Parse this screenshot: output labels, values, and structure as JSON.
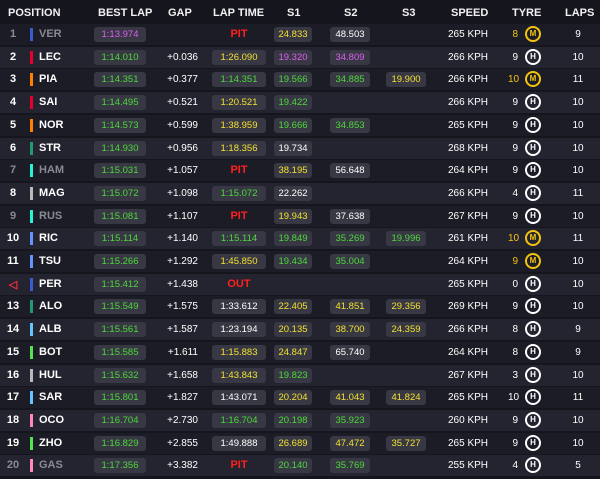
{
  "headers": {
    "position": "POSITION",
    "best_lap": "BEST LAP",
    "gap": "GAP",
    "lap_time": "LAP TIME",
    "s1": "S1",
    "s2": "S2",
    "s3": "S3",
    "speed": "SPEED",
    "tyre": "TYRE",
    "laps": "LAPS"
  },
  "colors": {
    "purple": "#e05cf5",
    "green": "#4cd93a",
    "yellow": "#f2e12e",
    "white": "#ffffff",
    "pit_red": "#ff2020",
    "tyre_medium": "#f2c40f",
    "tyre_hard": "#ffffff"
  },
  "rows": [
    {
      "pos": "1",
      "code": "VER",
      "team": "#3a5bd0",
      "dim": true,
      "best": "1:13.974",
      "best_c": "purple",
      "gap": "",
      "lap": "PIT",
      "lap_c": "pit",
      "s1": "24.833",
      "s1_c": "yellow",
      "s2": "48.503",
      "s2_c": "white",
      "s3": "",
      "s3_c": "",
      "speed": "265 KPH",
      "age": "8",
      "tyre": "M",
      "tyre_c": "yellow",
      "laps": "9"
    },
    {
      "pos": "2",
      "code": "LEC",
      "team": "#e8002d",
      "dim": false,
      "best": "1:14.010",
      "best_c": "green",
      "gap": "+0.036",
      "lap": "1:26.090",
      "lap_c": "yellow",
      "s1": "19.320",
      "s1_c": "purple",
      "s2": "34.809",
      "s2_c": "purple",
      "s3": "",
      "s3_c": "",
      "speed": "266 KPH",
      "age": "9",
      "tyre": "H",
      "tyre_c": "white",
      "laps": "10"
    },
    {
      "pos": "3",
      "code": "PIA",
      "team": "#ff8000",
      "dim": false,
      "best": "1:14.351",
      "best_c": "green",
      "gap": "+0.377",
      "lap": "1:14.351",
      "lap_c": "green",
      "s1": "19.566",
      "s1_c": "green",
      "s2": "34.885",
      "s2_c": "green",
      "s3": "19.900",
      "s3_c": "yellow",
      "speed": "266 KPH",
      "age": "10",
      "tyre": "M",
      "tyre_c": "yellow",
      "laps": "11"
    },
    {
      "pos": "4",
      "code": "SAI",
      "team": "#e8002d",
      "dim": false,
      "best": "1:14.495",
      "best_c": "green",
      "gap": "+0.521",
      "lap": "1:20.521",
      "lap_c": "yellow",
      "s1": "19.422",
      "s1_c": "green",
      "s2": "",
      "s2_c": "",
      "s3": "",
      "s3_c": "",
      "speed": "266 KPH",
      "age": "9",
      "tyre": "H",
      "tyre_c": "white",
      "laps": "10"
    },
    {
      "pos": "5",
      "code": "NOR",
      "team": "#ff8000",
      "dim": false,
      "best": "1:14.573",
      "best_c": "green",
      "gap": "+0.599",
      "lap": "1:38.959",
      "lap_c": "yellow",
      "s1": "19.666",
      "s1_c": "green",
      "s2": "34.853",
      "s2_c": "green",
      "s3": "",
      "s3_c": "",
      "speed": "265 KPH",
      "age": "9",
      "tyre": "H",
      "tyre_c": "white",
      "laps": "10"
    },
    {
      "pos": "6",
      "code": "STR",
      "team": "#229971",
      "dim": false,
      "best": "1:14.930",
      "best_c": "green",
      "gap": "+0.956",
      "lap": "1:18.356",
      "lap_c": "yellow",
      "s1": "19.734",
      "s1_c": "white",
      "s2": "",
      "s2_c": "",
      "s3": "",
      "s3_c": "",
      "speed": "268 KPH",
      "age": "9",
      "tyre": "H",
      "tyre_c": "white",
      "laps": "10"
    },
    {
      "pos": "7",
      "code": "HAM",
      "team": "#27f4d2",
      "dim": true,
      "best": "1:15.031",
      "best_c": "green",
      "gap": "+1.057",
      "lap": "PIT",
      "lap_c": "pit",
      "s1": "38.195",
      "s1_c": "yellow",
      "s2": "56.648",
      "s2_c": "white",
      "s3": "",
      "s3_c": "",
      "speed": "264 KPH",
      "age": "9",
      "tyre": "H",
      "tyre_c": "white",
      "laps": "10"
    },
    {
      "pos": "8",
      "code": "MAG",
      "team": "#b6babd",
      "dim": false,
      "best": "1:15.072",
      "best_c": "green",
      "gap": "+1.098",
      "lap": "1:15.072",
      "lap_c": "green",
      "s1": "22.262",
      "s1_c": "white",
      "s2": "",
      "s2_c": "",
      "s3": "",
      "s3_c": "",
      "speed": "266 KPH",
      "age": "4",
      "tyre": "H",
      "tyre_c": "white",
      "laps": "11"
    },
    {
      "pos": "9",
      "code": "RUS",
      "team": "#27f4d2",
      "dim": true,
      "best": "1:15.081",
      "best_c": "green",
      "gap": "+1.107",
      "lap": "PIT",
      "lap_c": "pit",
      "s1": "19.943",
      "s1_c": "yellow",
      "s2": "37.638",
      "s2_c": "white",
      "s3": "",
      "s3_c": "",
      "speed": "267 KPH",
      "age": "9",
      "tyre": "H",
      "tyre_c": "white",
      "laps": "10"
    },
    {
      "pos": "10",
      "code": "RIC",
      "team": "#6692ff",
      "dim": false,
      "best": "1:15.114",
      "best_c": "green",
      "gap": "+1.140",
      "lap": "1:15.114",
      "lap_c": "green",
      "s1": "19.849",
      "s1_c": "green",
      "s2": "35.269",
      "s2_c": "green",
      "s3": "19.996",
      "s3_c": "green",
      "speed": "261 KPH",
      "age": "10",
      "tyre": "M",
      "tyre_c": "yellow",
      "laps": "11"
    },
    {
      "pos": "11",
      "code": "TSU",
      "team": "#6692ff",
      "dim": false,
      "best": "1:15.266",
      "best_c": "green",
      "gap": "+1.292",
      "lap": "1:45.850",
      "lap_c": "yellow",
      "s1": "19.434",
      "s1_c": "green",
      "s2": "35.004",
      "s2_c": "green",
      "s3": "",
      "s3_c": "",
      "speed": "264 KPH",
      "age": "9",
      "tyre": "M",
      "tyre_c": "yellow",
      "laps": "10"
    },
    {
      "pos": "◁",
      "code": "PER",
      "team": "#3a5bd0",
      "dim": false,
      "best": "1:15.412",
      "best_c": "green",
      "gap": "+1.438",
      "lap": "OUT",
      "lap_c": "pit",
      "s1": "",
      "s1_c": "",
      "s2": "",
      "s2_c": "",
      "s3": "",
      "s3_c": "",
      "speed": "265 KPH",
      "age": "0",
      "tyre": "H",
      "tyre_c": "white",
      "laps": "10"
    },
    {
      "pos": "13",
      "code": "ALO",
      "team": "#229971",
      "dim": false,
      "best": "1:15.549",
      "best_c": "green",
      "gap": "+1.575",
      "lap": "1:33.612",
      "lap_c": "white",
      "s1": "22.405",
      "s1_c": "yellow",
      "s2": "41.851",
      "s2_c": "yellow",
      "s3": "29.356",
      "s3_c": "yellow",
      "speed": "269 KPH",
      "age": "9",
      "tyre": "H",
      "tyre_c": "white",
      "laps": "10"
    },
    {
      "pos": "14",
      "code": "ALB",
      "team": "#64c4ff",
      "dim": false,
      "best": "1:15.561",
      "best_c": "green",
      "gap": "+1.587",
      "lap": "1:23.194",
      "lap_c": "white",
      "s1": "20.135",
      "s1_c": "yellow",
      "s2": "38.700",
      "s2_c": "yellow",
      "s3": "24.359",
      "s3_c": "yellow",
      "speed": "266 KPH",
      "age": "8",
      "tyre": "H",
      "tyre_c": "white",
      "laps": "9"
    },
    {
      "pos": "15",
      "code": "BOT",
      "team": "#52e252",
      "dim": false,
      "best": "1:15.585",
      "best_c": "green",
      "gap": "+1.611",
      "lap": "1:15.883",
      "lap_c": "yellow",
      "s1": "24.847",
      "s1_c": "yellow",
      "s2": "65.740",
      "s2_c": "white",
      "s3": "",
      "s3_c": "",
      "speed": "264 KPH",
      "age": "8",
      "tyre": "H",
      "tyre_c": "white",
      "laps": "9"
    },
    {
      "pos": "16",
      "code": "HUL",
      "team": "#b6babd",
      "dim": false,
      "best": "1:15.632",
      "best_c": "green",
      "gap": "+1.658",
      "lap": "1:43.843",
      "lap_c": "yellow",
      "s1": "19.823",
      "s1_c": "green",
      "s2": "",
      "s2_c": "",
      "s3": "",
      "s3_c": "",
      "speed": "267 KPH",
      "age": "3",
      "tyre": "H",
      "tyre_c": "white",
      "laps": "10"
    },
    {
      "pos": "17",
      "code": "SAR",
      "team": "#64c4ff",
      "dim": false,
      "best": "1:15.801",
      "best_c": "green",
      "gap": "+1.827",
      "lap": "1:43.071",
      "lap_c": "white",
      "s1": "20.204",
      "s1_c": "yellow",
      "s2": "41.043",
      "s2_c": "yellow",
      "s3": "41.824",
      "s3_c": "yellow",
      "speed": "265 KPH",
      "age": "10",
      "tyre": "H",
      "tyre_c": "white",
      "laps": "11"
    },
    {
      "pos": "18",
      "code": "OCO",
      "team": "#ff87bc",
      "dim": false,
      "best": "1:16.704",
      "best_c": "green",
      "gap": "+2.730",
      "lap": "1:16.704",
      "lap_c": "green",
      "s1": "20.198",
      "s1_c": "green",
      "s2": "35.923",
      "s2_c": "green",
      "s3": "",
      "s3_c": "",
      "speed": "260 KPH",
      "age": "9",
      "tyre": "H",
      "tyre_c": "white",
      "laps": "10"
    },
    {
      "pos": "19",
      "code": "ZHO",
      "team": "#52e252",
      "dim": false,
      "best": "1:16.829",
      "best_c": "green",
      "gap": "+2.855",
      "lap": "1:49.888",
      "lap_c": "white",
      "s1": "26.689",
      "s1_c": "yellow",
      "s2": "47.472",
      "s2_c": "yellow",
      "s3": "35.727",
      "s3_c": "yellow",
      "speed": "265 KPH",
      "age": "9",
      "tyre": "H",
      "tyre_c": "white",
      "laps": "10"
    },
    {
      "pos": "20",
      "code": "GAS",
      "team": "#ff87bc",
      "dim": true,
      "best": "1:17.356",
      "best_c": "green",
      "gap": "+3.382",
      "lap": "PIT",
      "lap_c": "pit",
      "s1": "20.140",
      "s1_c": "green",
      "s2": "35.769",
      "s2_c": "green",
      "s3": "",
      "s3_c": "",
      "speed": "255 KPH",
      "age": "4",
      "tyre": "H",
      "tyre_c": "white",
      "laps": "5"
    }
  ]
}
